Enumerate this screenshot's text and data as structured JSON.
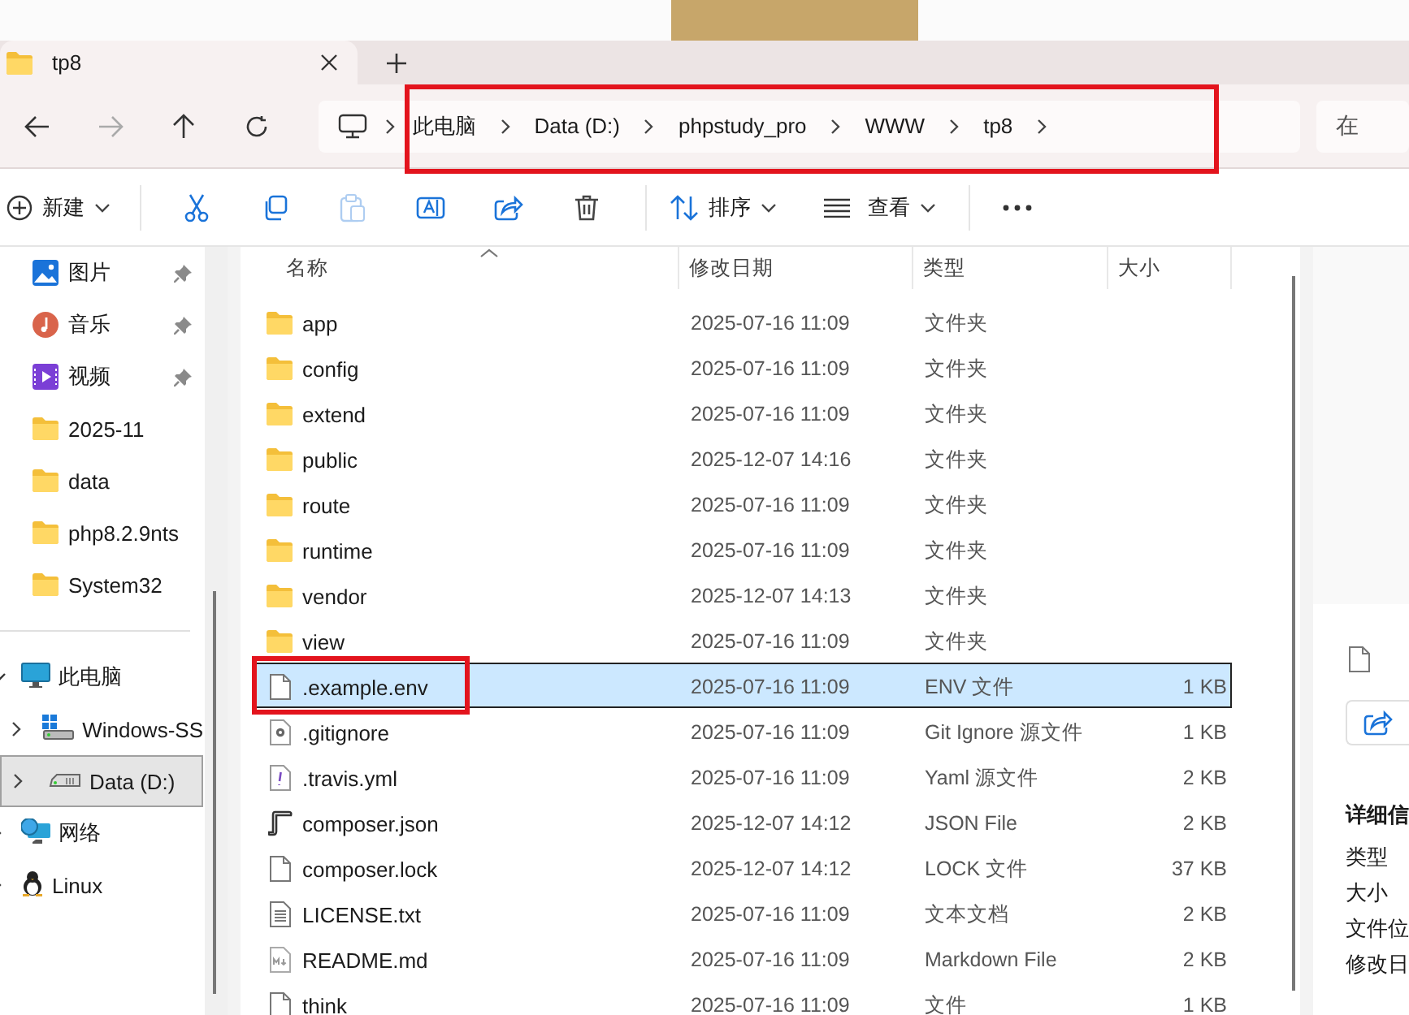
{
  "tab": {
    "title": "tp8",
    "selected": true
  },
  "breadcrumb": {
    "items": [
      "此电脑",
      "Data (D:)",
      "phpstudy_pro",
      "WWW",
      "tp8"
    ],
    "highlighted": true
  },
  "search": {
    "placeholder": "在"
  },
  "toolbar": {
    "new": "新建",
    "sort": "排序",
    "view": "查看",
    "tools": [
      {
        "kind": "cut",
        "disabled": false
      },
      {
        "kind": "copy",
        "disabled": false
      },
      {
        "kind": "paste",
        "disabled": true
      },
      {
        "kind": "rename",
        "disabled": false
      },
      {
        "kind": "share",
        "disabled": false
      },
      {
        "kind": "delete",
        "disabled": false
      }
    ]
  },
  "sidebar": {
    "quick_access": [
      {
        "label": "图片",
        "kind": "pictures",
        "pinned": true
      },
      {
        "label": "音乐",
        "kind": "music",
        "pinned": true
      },
      {
        "label": "视频",
        "kind": "videos",
        "pinned": true
      },
      {
        "label": "2025-11",
        "kind": "folder",
        "pinned": false
      },
      {
        "label": "data",
        "kind": "folder",
        "pinned": false
      },
      {
        "label": "php8.2.9nts",
        "kind": "folder",
        "pinned": false
      },
      {
        "label": "System32",
        "kind": "folder",
        "pinned": false
      }
    ],
    "tree": [
      {
        "label": "此电脑",
        "kind": "pc",
        "expanded": true,
        "selected": false,
        "children": [
          {
            "label": "Windows-SS",
            "kind": "windrive",
            "expanded": false,
            "selected": false
          },
          {
            "label": "Data (D:)",
            "kind": "drive",
            "expanded": false,
            "selected": true
          }
        ]
      },
      {
        "label": "网络",
        "kind": "network",
        "expanded": false,
        "selected": false
      },
      {
        "label": "Linux",
        "kind": "linux",
        "expanded": false,
        "selected": false
      }
    ]
  },
  "table": {
    "columns": [
      "名称",
      "修改日期",
      "类型",
      "大小"
    ],
    "rows": [
      {
        "name": "app",
        "date": "2025-07-16 11:09",
        "type": "文件夹",
        "kind": "folder",
        "selected": false,
        "highlighted": false
      },
      {
        "name": "config",
        "date": "2025-07-16 11:09",
        "type": "文件夹",
        "kind": "folder",
        "selected": false,
        "highlighted": false
      },
      {
        "name": "extend",
        "date": "2025-07-16 11:09",
        "type": "文件夹",
        "kind": "folder",
        "selected": false,
        "highlighted": false
      },
      {
        "name": "public",
        "date": "2025-12-07 14:16",
        "type": "文件夹",
        "kind": "folder",
        "selected": false,
        "highlighted": false
      },
      {
        "name": "route",
        "date": "2025-07-16 11:09",
        "type": "文件夹",
        "kind": "folder",
        "selected": false,
        "highlighted": false
      },
      {
        "name": "runtime",
        "date": "2025-07-16 11:09",
        "type": "文件夹",
        "kind": "folder",
        "selected": false,
        "highlighted": false
      },
      {
        "name": "vendor",
        "date": "2025-12-07 14:13",
        "type": "文件夹",
        "kind": "folder",
        "selected": false,
        "highlighted": false
      },
      {
        "name": "view",
        "date": "2025-07-16 11:09",
        "type": "文件夹",
        "kind": "folder",
        "selected": false,
        "highlighted": false
      },
      {
        "name": ".example.env",
        "date": "2025-07-16 11:09",
        "type": "ENV 文件",
        "size": "1 KB",
        "kind": "blank",
        "selected": true,
        "highlighted": true
      },
      {
        "name": ".gitignore",
        "date": "2025-07-16 11:09",
        "type": "Git Ignore 源文件",
        "size": "1 KB",
        "kind": "config",
        "selected": false,
        "highlighted": false
      },
      {
        "name": ".travis.yml",
        "date": "2025-07-16 11:09",
        "type": "Yaml 源文件",
        "size": "2 KB",
        "kind": "yaml",
        "selected": false,
        "highlighted": false
      },
      {
        "name": "composer.json",
        "date": "2025-12-07 14:12",
        "type": "JSON File",
        "size": "2 KB",
        "kind": "script",
        "selected": false,
        "highlighted": false
      },
      {
        "name": "composer.lock",
        "date": "2025-12-07 14:12",
        "type": "LOCK 文件",
        "size": "37 KB",
        "kind": "blank",
        "selected": false,
        "highlighted": false
      },
      {
        "name": "LICENSE.txt",
        "date": "2025-07-16 11:09",
        "type": "文本文档",
        "size": "2 KB",
        "kind": "text",
        "selected": false,
        "highlighted": false
      },
      {
        "name": "README.md",
        "date": "2025-07-16 11:09",
        "type": "Markdown File",
        "size": "2 KB",
        "kind": "markdown",
        "selected": false,
        "highlighted": false
      },
      {
        "name": "think",
        "date": "2025-07-16 11:09",
        "type": "文件",
        "size": "1 KB",
        "kind": "blank",
        "selected": false,
        "highlighted": false
      }
    ]
  },
  "details": {
    "heading": "详细信",
    "labels": [
      "类型",
      "大小",
      "文件位",
      "修改日"
    ]
  }
}
